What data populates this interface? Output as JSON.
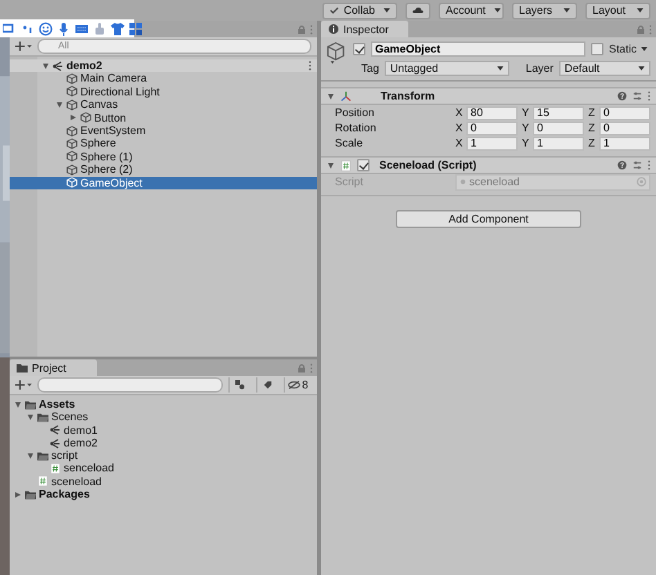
{
  "toolbar": {
    "buttons": [
      {
        "kind": "collab",
        "label": "Collab"
      },
      {
        "kind": "cloud"
      },
      {
        "kind": "dropdown",
        "label": "Account"
      },
      {
        "kind": "dropdown",
        "label": "Layers"
      },
      {
        "kind": "dropdown",
        "label": "Layout"
      }
    ]
  },
  "hierarchy": {
    "search": {
      "placeholder": "All"
    },
    "tree": [
      {
        "label": "demo2",
        "kind": "scene",
        "expanded": true,
        "selected": false,
        "children": [
          {
            "label": "Main Camera",
            "kind": "object",
            "selected": false
          },
          {
            "label": "Directional Light",
            "kind": "object",
            "selected": false
          },
          {
            "label": "Canvas",
            "kind": "object",
            "expanded": true,
            "selected": false,
            "children": [
              {
                "label": "Button",
                "kind": "object",
                "expanded": false,
                "selected": false
              }
            ]
          },
          {
            "label": "EventSystem",
            "kind": "object",
            "selected": false
          },
          {
            "label": "Sphere",
            "kind": "object",
            "selected": false
          },
          {
            "label": "Sphere (1)",
            "kind": "object",
            "selected": false
          },
          {
            "label": "Sphere (2)",
            "kind": "object",
            "selected": false
          },
          {
            "label": "GameObject",
            "kind": "object",
            "selected": true
          }
        ]
      }
    ]
  },
  "project": {
    "tab": "Project",
    "hidden_count": "8",
    "tree": [
      {
        "label": "Assets",
        "kind": "folder",
        "expanded": true,
        "selected": false,
        "children": [
          {
            "label": "Scenes",
            "kind": "folder",
            "expanded": true,
            "selected": false,
            "children": [
              {
                "label": "demo1",
                "kind": "scene",
                "selected": false
              },
              {
                "label": "demo2",
                "kind": "scene",
                "selected": false
              }
            ]
          },
          {
            "label": "script",
            "kind": "folder",
            "expanded": true,
            "selected": false,
            "children": [
              {
                "label": "senceload",
                "kind": "script",
                "selected": false
              }
            ]
          },
          {
            "label": "sceneload",
            "kind": "script",
            "selected": false
          }
        ]
      },
      {
        "label": "Packages",
        "kind": "folder",
        "expanded": false,
        "selected": false
      }
    ]
  },
  "inspector": {
    "tab": "Inspector",
    "object": {
      "active": true,
      "name": "GameObject",
      "static_label": "Static",
      "static": false,
      "tag_label": "Tag",
      "tag": "Untagged",
      "layer_label": "Layer",
      "layer": "Default"
    },
    "components": [
      {
        "kind": "transform",
        "title": "Transform",
        "expanded": true,
        "rows": [
          {
            "label": "Position",
            "fields": [
              {
                "axis": "X",
                "value": "80"
              },
              {
                "axis": "Y",
                "value": "15"
              },
              {
                "axis": "Z",
                "value": "0"
              }
            ]
          },
          {
            "label": "Rotation",
            "fields": [
              {
                "axis": "X",
                "value": "0"
              },
              {
                "axis": "Y",
                "value": "0"
              },
              {
                "axis": "Z",
                "value": "0"
              }
            ]
          },
          {
            "label": "Scale",
            "fields": [
              {
                "axis": "X",
                "value": "1"
              },
              {
                "axis": "Y",
                "value": "1"
              },
              {
                "axis": "Z",
                "value": "1"
              }
            ]
          }
        ]
      },
      {
        "kind": "script",
        "title": "Sceneload (Script)",
        "expanded": true,
        "enabled": true,
        "field": {
          "label": "Script",
          "value": "sceneload"
        }
      }
    ],
    "add_button": "Add Component"
  }
}
